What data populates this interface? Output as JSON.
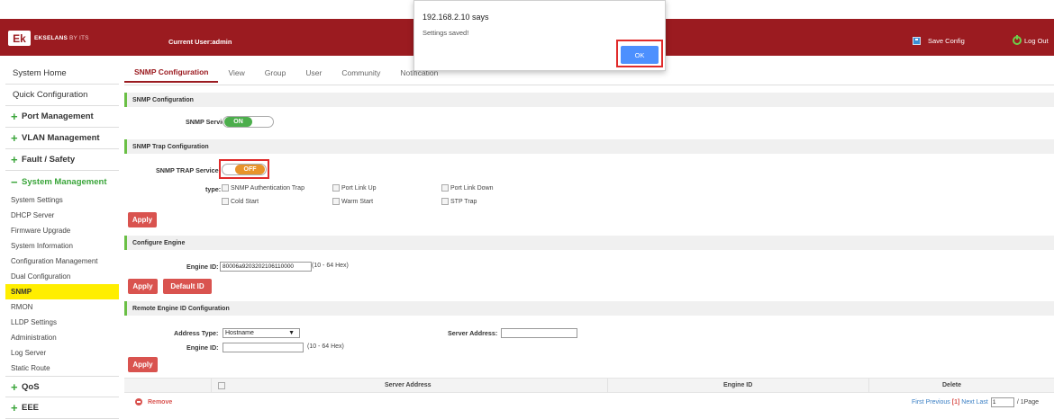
{
  "header": {
    "logo_mark": "Ek",
    "brand": "EKSELANS",
    "brand_suffix": "BY ITS",
    "current_user": "Current User:admin",
    "save_config": "Save Config",
    "logout": "Log Out",
    "bar_color": "#9b1b20"
  },
  "sidebar": {
    "top_items": [
      "System Home",
      "Quick Configuration"
    ],
    "groups_before": [
      {
        "sign": "+",
        "label": "Port Management"
      },
      {
        "sign": "+",
        "label": "VLAN Management"
      },
      {
        "sign": "+",
        "label": "Fault / Safety"
      }
    ],
    "active_group": {
      "sign": "−",
      "label": "System Management"
    },
    "subitems": [
      "System Settings",
      "DHCP Server",
      "Firmware Upgrade",
      "System Information",
      "Configuration Management",
      "Dual Configuration",
      "SNMP",
      "RMON",
      "LLDP Settings",
      "Administration",
      "Log Server",
      "Static Route"
    ],
    "selected_subitem": "SNMP",
    "groups_after": [
      {
        "sign": "+",
        "label": "QoS"
      },
      {
        "sign": "+",
        "label": "EEE"
      }
    ]
  },
  "tabs": [
    "SNMP Configuration",
    "View",
    "Group",
    "User",
    "Community",
    "Notification"
  ],
  "snmp_config": {
    "heading": "SNMP Configuration",
    "service_label": "SNMP Service:",
    "service_state": "ON"
  },
  "trap_config": {
    "heading": "SNMP Trap Configuration",
    "service_label": "SNMP TRAP Service",
    "service_state": "OFF",
    "type_label": "type:",
    "types": [
      "SNMP Authentication Trap",
      "Port Link Up",
      "Port Link Down",
      "Cold Start",
      "Warm Start",
      "STP Trap"
    ],
    "apply": "Apply"
  },
  "engine": {
    "heading": "Configure Engine",
    "engine_id_label": "Engine ID:",
    "engine_id_value": "80006a9203202106110000",
    "hint": "(10 - 64 Hex)",
    "apply": "Apply",
    "default_id": "Default ID"
  },
  "remote_engine": {
    "heading": "Remote Engine ID Configuration",
    "address_type_label": "Address Type:",
    "address_type_value": "Hostname",
    "server_address_label": "Server Address:",
    "server_address_value": "",
    "engine_id_label": "Engine ID:",
    "engine_id_value": "",
    "hint": "(10 - 64 Hex)",
    "apply": "Apply"
  },
  "table": {
    "columns": [
      "Server Address",
      "Engine ID",
      "Delete"
    ],
    "remove": "Remove",
    "pager": {
      "first": "First",
      "previous": "Previous",
      "current": "[1]",
      "next": "Next",
      "last": "Last",
      "page_value": "1",
      "total": "/ 1Page"
    }
  },
  "dialog": {
    "title": "192.168.2.10 says",
    "message": "Settings saved!",
    "ok": "OK"
  }
}
